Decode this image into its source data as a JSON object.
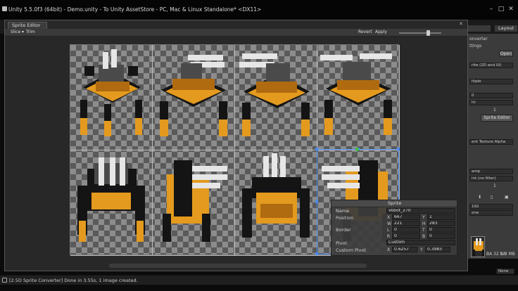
{
  "window": {
    "title": "Unity 5.5.0f3 (64bit) - Demo.unity - To Unity AssetStore - PC, Mac & Linux Standalone* <DX11>"
  },
  "toolbar": {
    "layers_label": "",
    "layout_label": "Layout"
  },
  "sprite_editor": {
    "tab_label": "Sprite Editor",
    "slice_label": "Slice ▾",
    "trim_label": "Trim",
    "revert_label": "Revert",
    "apply_label": "Apply",
    "zoom_level": 0.7
  },
  "sprite_panel": {
    "header": "Sprite",
    "name_label": "Name",
    "name_value": "Vobot_270",
    "position_label": "Position",
    "x_label": "X",
    "x_value": "667",
    "y_label": "Y",
    "y_value": "1",
    "w_label": "W",
    "w_value": "221",
    "h_label": "H",
    "h_value": "283",
    "border_label": "Border",
    "l_label": "L",
    "l_value": "0",
    "t_label": "T",
    "t_value": "0",
    "r_label": "R",
    "r_value": "0",
    "b_label": "B",
    "b_value": "0",
    "pivot_label": "Pivot",
    "pivot_value": "Custom",
    "custom_pivot_label": "Custom Pivot",
    "cp_x_label": "X",
    "cp_x_value": "0.6257",
    "cp_y_label": "Y",
    "cp_y_value": "0.3983"
  },
  "inspector": {
    "header_frag": "onverter",
    "settings_frag": "ttings",
    "open_btn": "Open",
    "texture_type": "rite (2D and UI)",
    "sprite_mode": "ltiple",
    "field_a": "0",
    "field_b": "ht",
    "field_c": "1",
    "sprite_editor_btn": "Sprite Editor",
    "alpha_frag": "ent Texture Alpha",
    "wrap_frag": "amp",
    "filter_frag": "int (no filter)",
    "aniso_value": "1",
    "size_value": "192",
    "compression_frag": "one",
    "format_frag": "BA 32 bit",
    "size_info": "1.9 MB",
    "bottom_frag": "None"
  },
  "status": {
    "text": "[2.5D Sprite Converter] Done in 3.55s, 1 image created."
  },
  "colors": {
    "orange": "#e39a1e",
    "dark_orange": "#b06a10",
    "black": "#141414",
    "gray": "#4a4a4a",
    "white": "#e6e6e6",
    "selection": "#4a8af0"
  }
}
